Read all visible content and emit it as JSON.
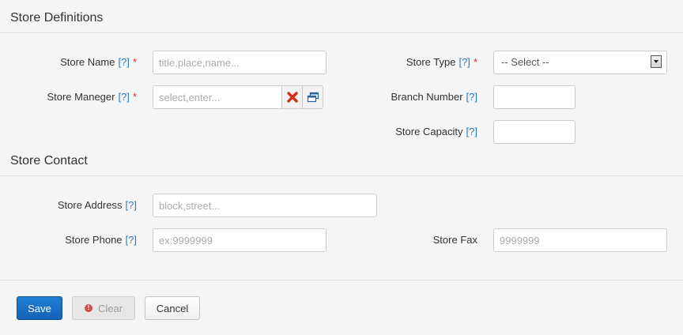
{
  "sections": {
    "definitions_title": "Store Definitions",
    "contact_title": "Store Contact"
  },
  "help_marker": "[?]",
  "required_marker": "*",
  "fields": {
    "store_name": {
      "label": "Store Name",
      "placeholder": "title,place,name..."
    },
    "store_manager": {
      "label": "Store Maneger",
      "placeholder": "select,enter..."
    },
    "store_type": {
      "label": "Store Type",
      "selected": "-- Select --"
    },
    "branch_number": {
      "label": "Branch Number"
    },
    "store_capacity": {
      "label": "Store Capacity"
    },
    "store_address": {
      "label": "Store Address",
      "placeholder": "block,street..."
    },
    "store_phone": {
      "label": "Store Phone",
      "placeholder": "ex:9999999"
    },
    "store_fax": {
      "label": "Store Fax",
      "placeholder": "9999999"
    }
  },
  "buttons": {
    "save": "Save",
    "clear": "Clear",
    "clear_icon_glyph": "!",
    "cancel": "Cancel"
  },
  "colors": {
    "help_link": "#2a7ab9",
    "required": "#d9342b",
    "primary": "#1562b7",
    "clear_icon_red": "#d42a1f"
  }
}
